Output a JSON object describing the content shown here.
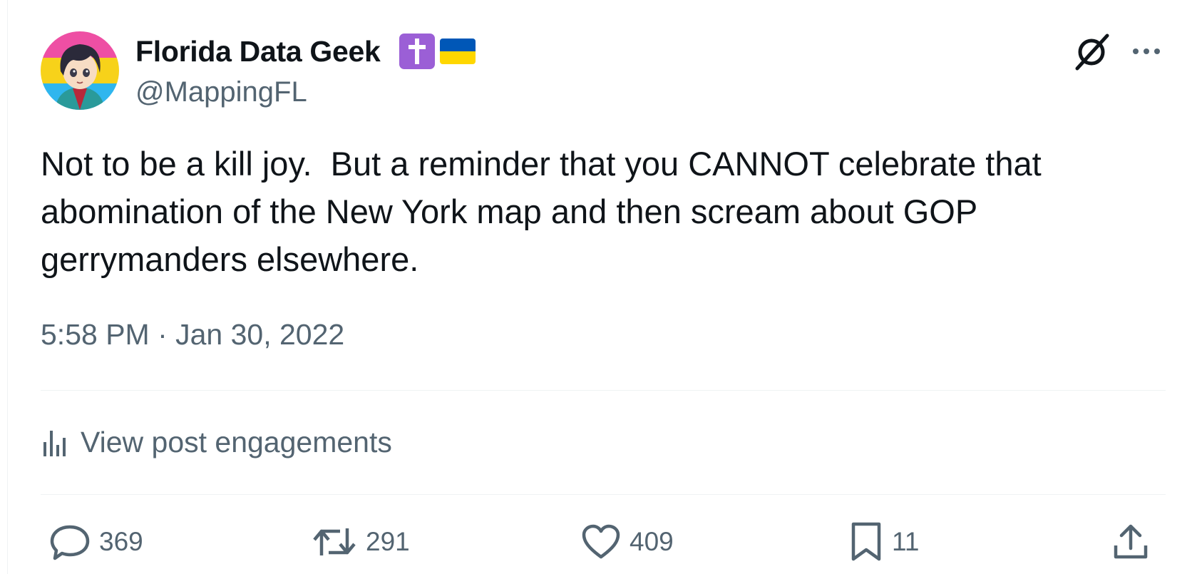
{
  "author": {
    "display_name": "Florida Data Geek",
    "handle": "@MappingFL",
    "badges": [
      "latin-cross-emoji",
      "ukraine-flag-emoji"
    ],
    "avatar": "pride-flag-anime-avatar"
  },
  "header_icons": [
    "grok-icon",
    "more-icon"
  ],
  "tweet": {
    "text": "Not to be a kill joy.  But a reminder that you CANNOT celebrate that\nabomination of the New York map and then scream about GOP\ngerrymanders elsewhere.",
    "timestamp": "5:58 PM · Jan 30, 2022"
  },
  "engagements_link": {
    "label": "View post engagements",
    "icon": "analytics-icon"
  },
  "actions": {
    "reply": {
      "count": "369",
      "icon": "reply-icon"
    },
    "retweet": {
      "count": "291",
      "icon": "retweet-icon"
    },
    "like": {
      "count": "409",
      "icon": "heart-icon"
    },
    "bookmark": {
      "count": "11",
      "icon": "bookmark-icon"
    },
    "share": {
      "icon": "share-icon"
    }
  },
  "colors": {
    "text_primary": "#0f1419",
    "text_secondary": "#536471",
    "divider": "#eff3f4",
    "badge_purple": "#9b5fd6",
    "flag_blue": "#0057b7",
    "flag_yellow": "#ffd700"
  }
}
